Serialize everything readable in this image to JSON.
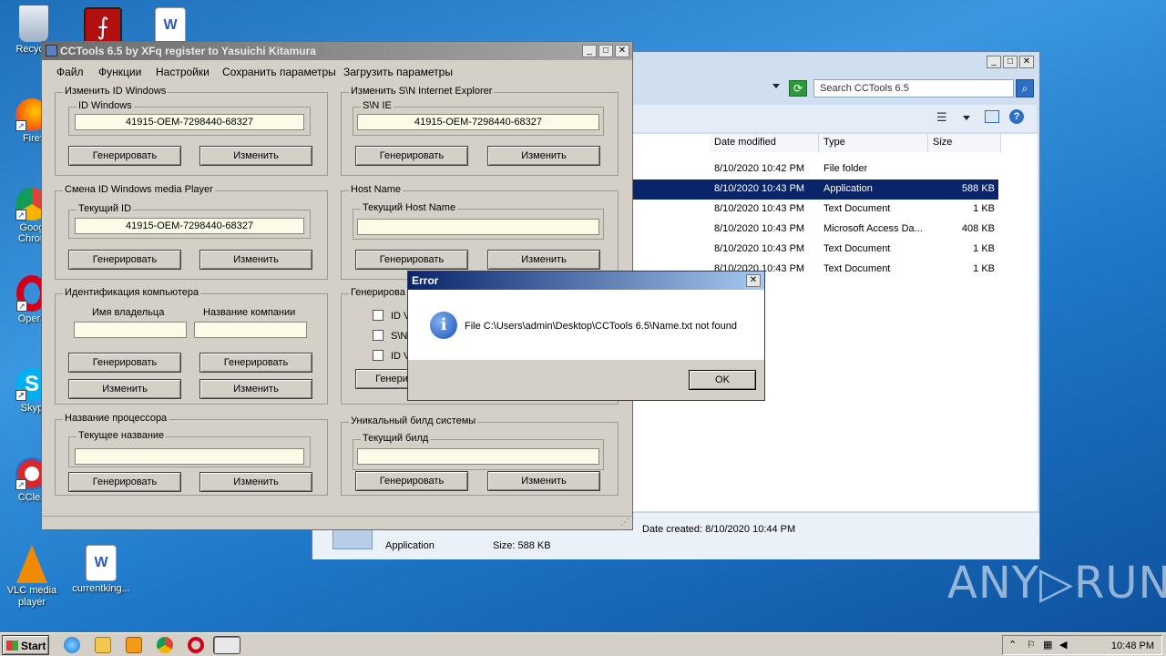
{
  "desktop": {
    "icons": [
      {
        "label": "Recycle"
      },
      {
        "label": "Firefo"
      },
      {
        "label": "Goog\nChron"
      },
      {
        "label": "Opera"
      },
      {
        "label": "Skyp"
      },
      {
        "label": "CClea"
      },
      {
        "label": "VLC media\nplayer"
      },
      {
        "label": "currentking..."
      }
    ]
  },
  "explorer": {
    "search_placeholder": "Search CCTools 6.5",
    "columns": [
      "Date modified",
      "Type",
      "Size"
    ],
    "rows": [
      {
        "date": "8/10/2020 10:42 PM",
        "type": "File folder",
        "size": ""
      },
      {
        "date": "8/10/2020 10:43 PM",
        "type": "Application",
        "size": "588 KB"
      },
      {
        "date": "8/10/2020 10:43 PM",
        "type": "Text Document",
        "size": "1 KB"
      },
      {
        "date": "8/10/2020 10:43 PM",
        "type": "Microsoft Access Da...",
        "size": "408 KB"
      },
      {
        "date": "8/10/2020 10:43 PM",
        "type": "Text Document",
        "size": "1 KB"
      },
      {
        "date": "8/10/2020 10:43 PM",
        "type": "Text Document",
        "size": "1 KB"
      }
    ],
    "details": {
      "date_created": "Date created: 8/10/2020 10:44 PM",
      "kind": "Application",
      "size": "Size: 588 KB"
    }
  },
  "cctools": {
    "title": "CCTools 6.5 by XFq register to Yasuichi Kitamura",
    "menu": [
      "Файл",
      "Функции",
      "Настройки",
      "Сохранить параметры",
      "Загрузить параметры"
    ],
    "windows_id": {
      "group": "Изменить ID Windows",
      "sub": "ID Windows",
      "value": "41915-OEM-7298440-68327",
      "gen": "Генерировать",
      "change": "Изменить"
    },
    "ie_sn": {
      "group": "Изменить S\\N Internet Explorer",
      "sub": "S\\N IE",
      "value": "41915-OEM-7298440-68327",
      "gen": "Генерировать",
      "change": "Изменить"
    },
    "wmp_id": {
      "group": "Смена ID Windows media Player",
      "sub": "Текущий ID",
      "value": "41915-OEM-7298440-68327",
      "gen": "Генерировать",
      "change": "Изменить"
    },
    "host": {
      "group": "Host Name",
      "sub": "Текущий Host Name",
      "value": "",
      "gen": "Генерировать",
      "change": "Изменить"
    },
    "computer_id": {
      "group": "Идентификация компьютера",
      "owner_label": "Имя владельца",
      "company_label": "Название компании",
      "gen1": "Генерировать",
      "gen2": "Генерировать",
      "change1": "Изменить",
      "change2": "Изменить"
    },
    "generate_group": {
      "group": "Генерирова",
      "checks": [
        "ID V",
        "S\\N",
        "ID V"
      ],
      "button": "Генери"
    },
    "cpu": {
      "group": "Название процессора",
      "sub": "Текущее название",
      "gen": "Генерировать",
      "change": "Изменить"
    },
    "build": {
      "group": "Уникальный билд системы",
      "sub": "Текущий билд",
      "gen": "Генерировать",
      "change": "Изменить"
    }
  },
  "error_dialog": {
    "title": "Error",
    "message": "File C:\\Users\\admin\\Desktop\\CCTools 6.5\\Name.txt not found",
    "ok": "OK"
  },
  "taskbar": {
    "start": "Start",
    "clock": "10:48 PM"
  },
  "watermark": "ANY▷RUN"
}
